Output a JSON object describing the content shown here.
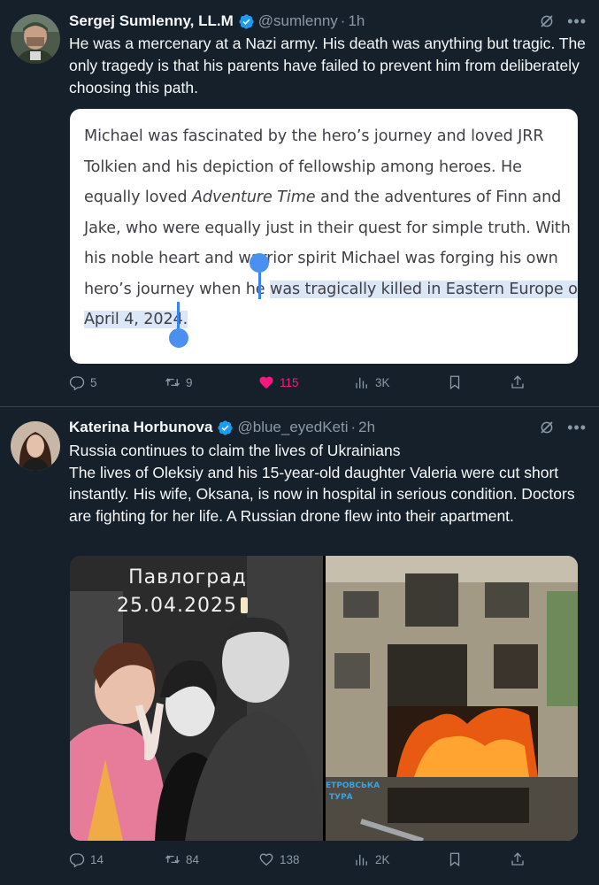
{
  "tweets": [
    {
      "author_name": "Sergej Sumlenny, LL.M",
      "handle": "@sumlenny",
      "separator": "·",
      "time": "1h",
      "text": "He was a mercenary at a Nazi army. His death was anything but tragic. The only tragedy is that his parents have failed to prevent him from deliberately choosing this path.",
      "quote_screenshot": {
        "line1": "Michael was fascinated by the hero’s journey and loved JRR",
        "line2": "Tolkien and his depiction of fellowship among heroes. He",
        "line3_pre": "equally loved ",
        "line3_em": "Adventure Time",
        "line3_post": " and the adventures of Finn and",
        "line4": "Jake, who were equally just in their quest for simple truth. With",
        "line5": "his noble heart and warrior spirit Michael was forging his own",
        "line6_pre": "hero’s journey when he ",
        "line6_hl": "was tragically killed in Eastern Europe on",
        "line7_hl": "April 4, 2024."
      },
      "actions": {
        "replies": "5",
        "retweets": "9",
        "likes": "115",
        "views": "3K"
      },
      "liked": true
    },
    {
      "author_name": "Katerina Horbunova",
      "handle": "@blue_eyedKeti",
      "separator": "·",
      "time": "2h",
      "text_line1": "Russia continues to claim the lives of Ukrainians",
      "text_line2": "The lives of Oleksiy and his 15-year-old daughter Valeria were cut short instantly. His wife, Oksana, is now in hospital in serious condition. Doctors are fighting for her life. A Russian drone flew into their apartment.",
      "media": {
        "left_caption_city": "Павлоград",
        "left_caption_date": "25.04.2025",
        "right_watermark_line1": "ЕТРОВСЬКА",
        "right_watermark_line2": "ТУРА"
      },
      "actions": {
        "replies": "14",
        "retweets": "84",
        "likes": "138",
        "views": "2K"
      },
      "liked": false
    }
  ],
  "colors": {
    "background": "#15202b",
    "text": "#f7f9f9",
    "muted": "#8b98a5",
    "verified": "#1d9bf0",
    "like": "#f91880",
    "selection": "#dbe7f7",
    "cursor": "#3b82f6"
  },
  "icons": [
    "verified-badge-icon",
    "grok-icon",
    "more-icon",
    "reply-icon",
    "retweet-icon",
    "like-icon",
    "views-icon",
    "bookmark-icon",
    "share-icon"
  ]
}
